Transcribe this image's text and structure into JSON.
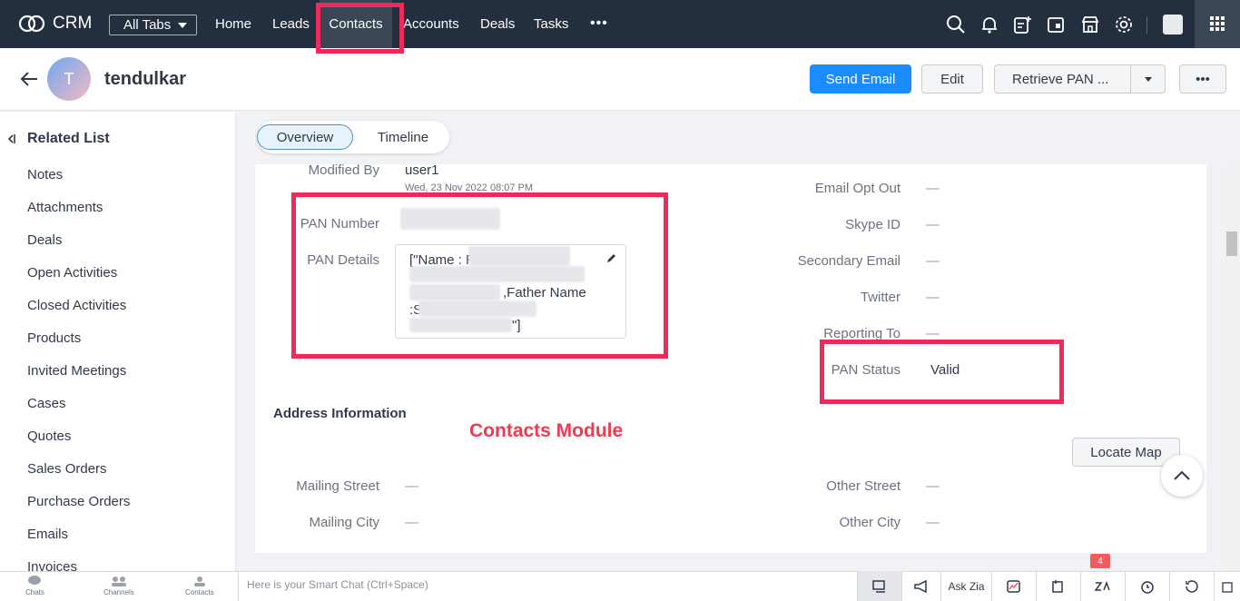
{
  "topbar": {
    "app_name": "CRM",
    "all_tabs": "All Tabs",
    "nav": [
      "Home",
      "Leads",
      "Contacts",
      "Accounts",
      "Deals",
      "Tasks"
    ],
    "more": "•••"
  },
  "record": {
    "avatar_letter": "T",
    "name": "tendulkar"
  },
  "actions": {
    "send_email": "Send Email",
    "edit": "Edit",
    "retrieve_pan": "Retrieve PAN ...",
    "more": "•••"
  },
  "sidebar": {
    "title": "Related List",
    "items": [
      "Notes",
      "Attachments",
      "Deals",
      "Open Activities",
      "Closed Activities",
      "Products",
      "Invited Meetings",
      "Cases",
      "Quotes",
      "Sales Orders",
      "Purchase Orders",
      "Emails",
      "Invoices"
    ]
  },
  "tabs": {
    "overview": "Overview",
    "timeline": "Timeline"
  },
  "details": {
    "modified_by_label": "Modified By",
    "modified_by_value": "user1",
    "modified_date": "Wed, 23 Nov 2022 08:07 PM",
    "pan_number_label": "PAN Number",
    "pan_details_label": "PAN Details",
    "pan_details_line1": "[\"Name : R",
    "pan_details_line2": ",Father Name",
    "pan_details_line3": ":S",
    "pan_details_line4": "\"]",
    "email_opt_out_label": "Email Opt Out",
    "skype_label": "Skype ID",
    "secondary_email_label": "Secondary Email",
    "twitter_label": "Twitter",
    "reporting_to_label": "Reporting To",
    "pan_status_label": "PAN Status",
    "pan_status_value": "Valid",
    "empty": "—"
  },
  "address": {
    "title": "Address Information",
    "mailing_street": "Mailing Street",
    "mailing_city": "Mailing City",
    "other_street": "Other Street",
    "other_city": "Other City",
    "locate_map": "Locate Map"
  },
  "overlay_text": "Contacts Module",
  "bottombar": {
    "chats": "Chats",
    "channels": "Channels",
    "contacts": "Contacts",
    "smart_chat_placeholder": "Here is your Smart Chat (Ctrl+Space)",
    "ask_zia": "Ask Zia",
    "zia_badge": "4"
  },
  "colors": {
    "topbar": "#232f3e",
    "primary": "#1a8cff",
    "highlight": "#ee2a5a"
  }
}
